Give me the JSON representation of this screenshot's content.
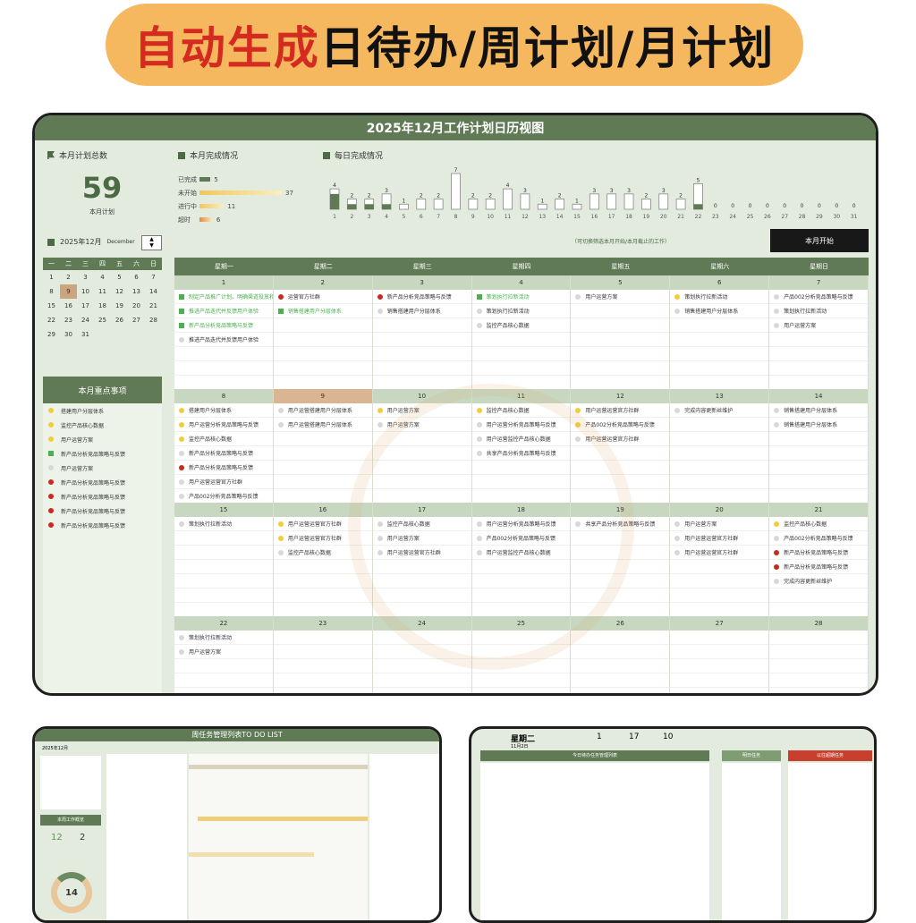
{
  "banner": {
    "highlight": "自动生成",
    "rest": "日待办/周计划/月计划"
  },
  "calendar": {
    "title": "2025年12月工作计划日历视图",
    "panels": {
      "total": "本月计划总数",
      "status": "本月完成情况",
      "daily": "每日完成情况"
    },
    "total_value": "59",
    "total_caption": "本月计划",
    "month": "2025年12月",
    "month_en": "December",
    "hint": "（可切换筛选本月开始/本月截止的工作）",
    "start_button": "本月开始",
    "mini_weekdays": [
      "一",
      "二",
      "三",
      "四",
      "五",
      "六",
      "日"
    ],
    "mini_days": [
      "1",
      "2",
      "3",
      "4",
      "5",
      "6",
      "7",
      "8",
      "9",
      "10",
      "11",
      "12",
      "13",
      "14",
      "15",
      "16",
      "17",
      "18",
      "19",
      "20",
      "21",
      "22",
      "23",
      "24",
      "25",
      "26",
      "27",
      "28",
      "29",
      "30",
      "31"
    ],
    "focus_title": "本月重点事项",
    "focus_items": [
      {
        "text": "搭建用户分层体系",
        "mark": "y"
      },
      {
        "text": "监控产品核心数据",
        "mark": "y"
      },
      {
        "text": "用户运营方案",
        "mark": "y"
      },
      {
        "text": "新产品分析竞品策略与反馈",
        "mark": "c"
      },
      {
        "text": "用户运营方案",
        "mark": "g"
      },
      {
        "text": "新产品分析竞品策略与反馈",
        "mark": "r"
      },
      {
        "text": "新产品分析竞品策略与反馈",
        "mark": "r"
      },
      {
        "text": "新产品分析竞品策略与反馈",
        "mark": "r"
      },
      {
        "text": "新产品分析竞品策略与反馈",
        "mark": "r"
      }
    ],
    "week_headers": [
      "星期一",
      "星期二",
      "星期三",
      "星期四",
      "星期五",
      "星期六",
      "星期日"
    ],
    "weeks": [
      [
        {
          "d": "1",
          "tasks": [
            {
              "t": "制定产品推广计划、明确渠道投放和",
              "m": "c"
            },
            {
              "t": "推进产品迭代并反馈用户体验",
              "m": "c"
            },
            {
              "t": "新产品分析竞品策略与反馈",
              "m": "c"
            },
            {
              "t": "推进产品迭代并反馈用户体验",
              "m": "g"
            }
          ]
        },
        {
          "d": "2",
          "tasks": [
            {
              "t": "运营官方社群",
              "m": "r"
            },
            {
              "t": "销售搭建用户分层体系",
              "m": "c"
            }
          ]
        },
        {
          "d": "3",
          "tasks": [
            {
              "t": "新产品分析竞品策略与反馈",
              "m": "r"
            },
            {
              "t": "销售搭建用户分层体系",
              "m": "g"
            }
          ]
        },
        {
          "d": "4",
          "tasks": [
            {
              "t": "策划执行拉新活动",
              "m": "c"
            },
            {
              "t": "策划执行拉新活动",
              "m": "g"
            },
            {
              "t": "监控产品核心数据",
              "m": "g"
            }
          ]
        },
        {
          "d": "5",
          "tasks": [
            {
              "t": "用户运营方案",
              "m": "g"
            }
          ]
        },
        {
          "d": "6",
          "tasks": [
            {
              "t": "策划执行拉新活动",
              "m": "y"
            },
            {
              "t": "销售搭建用户分层体系",
              "m": "g"
            }
          ]
        },
        {
          "d": "7",
          "tasks": [
            {
              "t": "产品002分析竞品策略与反馈",
              "m": "g"
            },
            {
              "t": "策划执行拉新活动",
              "m": "g"
            },
            {
              "t": "用户运营方案",
              "m": "g"
            }
          ]
        }
      ],
      [
        {
          "d": "8",
          "tasks": [
            {
              "t": "搭建用户分层体系",
              "m": "y"
            },
            {
              "t": "用户运营分析竞品策略与反馈",
              "m": "y"
            },
            {
              "t": "监控产品核心数据",
              "m": "y"
            },
            {
              "t": "新产品分析竞品策略与反馈",
              "m": "g"
            },
            {
              "t": "新产品分析竞品策略与反馈",
              "m": "r"
            },
            {
              "t": "用户运营运营官方社群",
              "m": "g"
            },
            {
              "t": "产品002分析竞品策略与反馈",
              "m": "g"
            }
          ]
        },
        {
          "d": "9",
          "hl": true,
          "tasks": [
            {
              "t": "用户运营搭建用户分层体系",
              "m": "g"
            },
            {
              "t": "用户运营搭建用户分层体系",
              "m": "g"
            }
          ]
        },
        {
          "d": "10",
          "tasks": [
            {
              "t": "用户运营方案",
              "m": "y"
            },
            {
              "t": "用户运营方案",
              "m": "g"
            }
          ]
        },
        {
          "d": "11",
          "tasks": [
            {
              "t": "监控产品核心数据",
              "m": "y"
            },
            {
              "t": "用户运营分析竞品策略与反馈",
              "m": "g"
            },
            {
              "t": "用户运营监控产品核心数据",
              "m": "g"
            },
            {
              "t": "共享产品分析竞品策略与反馈",
              "m": "g"
            }
          ]
        },
        {
          "d": "12",
          "tasks": [
            {
              "t": "用户运营运营官方社群",
              "m": "y"
            },
            {
              "t": "产品002分析竞品策略与反馈",
              "m": "y"
            },
            {
              "t": "用户运营运营官方社群",
              "m": "g"
            }
          ]
        },
        {
          "d": "13",
          "tasks": [
            {
              "t": "完成内容更新丝维护",
              "m": "g"
            }
          ]
        },
        {
          "d": "14",
          "tasks": [
            {
              "t": "销售搭建用户分层体系",
              "m": "g"
            },
            {
              "t": "销售搭建用户分层体系",
              "m": "g"
            }
          ]
        }
      ],
      [
        {
          "d": "15",
          "tasks": [
            {
              "t": "策划执行拉新活动",
              "m": "g"
            }
          ]
        },
        {
          "d": "16",
          "tasks": [
            {
              "t": "用户运营运营官方社群",
              "m": "y"
            },
            {
              "t": "用户运营运营官方社群",
              "m": "y"
            },
            {
              "t": "监控产品核心数据",
              "m": "g"
            }
          ]
        },
        {
          "d": "17",
          "tasks": [
            {
              "t": "监控产品核心数据",
              "m": "g"
            },
            {
              "t": "用户运营方案",
              "m": "g"
            },
            {
              "t": "用户运营运营官方社群",
              "m": "g"
            }
          ]
        },
        {
          "d": "18",
          "tasks": [
            {
              "t": "用户运营分析竞品策略与反馈",
              "m": "g"
            },
            {
              "t": "产品002分析竞品策略与反馈",
              "m": "g"
            },
            {
              "t": "用户运营监控产品核心数据",
              "m": "g"
            }
          ]
        },
        {
          "d": "19",
          "tasks": [
            {
              "t": "共享产品分析竞品策略与反馈",
              "m": "g"
            }
          ]
        },
        {
          "d": "20",
          "tasks": [
            {
              "t": "用户运营方案",
              "m": "g"
            },
            {
              "t": "用户运营运营官方社群",
              "m": "g"
            },
            {
              "t": "用户运营运营官方社群",
              "m": "g"
            }
          ]
        },
        {
          "d": "21",
          "tasks": [
            {
              "t": "监控产品核心数据",
              "m": "y"
            },
            {
              "t": "产品002分析竞品策略与反馈",
              "m": "g"
            },
            {
              "t": "新产品分析竞品策略与反馈",
              "m": "r"
            },
            {
              "t": "新产品分析竞品策略与反馈",
              "m": "r"
            },
            {
              "t": "完成内容更新丝维护",
              "m": "g"
            }
          ]
        }
      ],
      [
        {
          "d": "22",
          "tasks": [
            {
              "t": "策划执行拉新活动",
              "m": "g"
            },
            {
              "t": "用户运营方案",
              "m": "g"
            }
          ]
        },
        {
          "d": "23",
          "tasks": []
        },
        {
          "d": "24",
          "tasks": []
        },
        {
          "d": "25",
          "tasks": []
        },
        {
          "d": "26",
          "tasks": []
        },
        {
          "d": "27",
          "tasks": []
        },
        {
          "d": "28",
          "tasks": []
        }
      ]
    ]
  },
  "chart_data": [
    {
      "type": "bar",
      "title": "本月完成情况",
      "categories": [
        "已完成",
        "未开始",
        "进行中",
        "超时"
      ],
      "values": [
        5,
        37,
        11,
        6
      ],
      "colors": [
        "#5f7a55",
        "#f0c75a",
        "#f0c75a",
        "#e08b3c"
      ]
    },
    {
      "type": "bar",
      "title": "每日完成情况",
      "categories": [
        "1",
        "2",
        "3",
        "4",
        "5",
        "6",
        "7",
        "8",
        "9",
        "10",
        "11",
        "12",
        "13",
        "14",
        "15",
        "16",
        "17",
        "18",
        "19",
        "20",
        "21",
        "22",
        "23",
        "24",
        "25",
        "26",
        "27",
        "28",
        "29",
        "30",
        "31"
      ],
      "series": [
        {
          "values": [
            4,
            2,
            2,
            3,
            1,
            2,
            2,
            7,
            2,
            2,
            4,
            3,
            1,
            2,
            1,
            3,
            3,
            3,
            2,
            3,
            2,
            5,
            0,
            0,
            0,
            0,
            0,
            0,
            0,
            0,
            0
          ]
        },
        {
          "values": [
            3,
            1,
            1,
            1,
            0,
            0,
            0,
            0,
            0,
            0,
            0,
            0,
            0,
            0,
            0,
            0,
            0,
            0,
            0,
            0,
            0,
            1,
            0,
            0,
            0,
            0,
            0,
            0,
            0,
            0,
            0
          ]
        }
      ],
      "ylim": [
        0,
        7
      ]
    }
  ],
  "thumbs": {
    "weekly_title": "周任务管理列表TO DO LIST",
    "weekly_month": "2025年12月",
    "weekly_focus": "本周工作概览",
    "weekly_left": "12",
    "weekly_right": "2",
    "weekly_donut": "14",
    "daily_weekday": "星期二",
    "daily_date": "11月2日",
    "daily_stats": [
      "1",
      "17",
      "10"
    ],
    "daily_list_title": "今日待办任务管理列表",
    "daily_tomorrow": "明日任务",
    "daily_overdue": "以往超期任务"
  }
}
